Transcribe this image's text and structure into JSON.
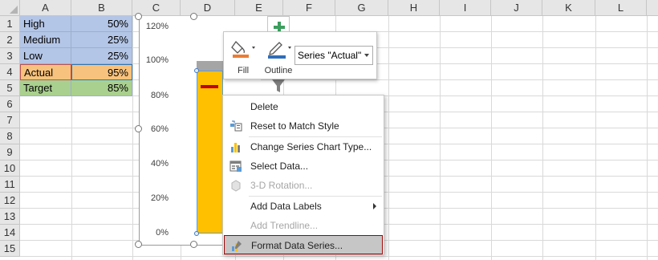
{
  "columns": [
    "A",
    "B",
    "C",
    "D",
    "E",
    "F",
    "G",
    "H",
    "I",
    "J",
    "K",
    "L"
  ],
  "rows": [
    "1",
    "2",
    "3",
    "4",
    "5",
    "6",
    "7",
    "8",
    "9",
    "10",
    "11",
    "12",
    "13",
    "14",
    "15"
  ],
  "cells": [
    {
      "label": "High",
      "value": "50%"
    },
    {
      "label": "Medium",
      "value": "25%"
    },
    {
      "label": "Low",
      "value": "25%"
    },
    {
      "label": "Actual",
      "value": "95%"
    },
    {
      "label": "Target",
      "value": "85%"
    }
  ],
  "chart": {
    "yticks": [
      "120%",
      "100%",
      "80%",
      "60%",
      "40%",
      "20%",
      "0%"
    ]
  },
  "chart_data": {
    "type": "bar",
    "categories": [
      ""
    ],
    "series": [
      {
        "values": [
          100
        ],
        "color": "#a5a5a5"
      },
      {
        "name": "Actual",
        "values": [
          95
        ],
        "color": "#ffc000"
      },
      {
        "values": [
          85
        ],
        "color": "#c00000"
      }
    ],
    "ylim": [
      0,
      120
    ],
    "yticks": [
      "120%",
      "100%",
      "80%",
      "60%",
      "40%",
      "20%",
      "0%"
    ]
  },
  "mini_toolbar": {
    "fill_label": "Fill",
    "outline_label": "Outline",
    "series_selector": "Series \"Actual\""
  },
  "context_menu": {
    "items": [
      {
        "label": "Delete",
        "icon": "none",
        "enabled": true
      },
      {
        "label": "Reset to Match Style",
        "icon": "reset-style-icon",
        "enabled": true
      },
      {
        "label": "Change Series Chart Type...",
        "icon": "bar-chart-icon",
        "enabled": true
      },
      {
        "label": "Select Data...",
        "icon": "select-data-icon",
        "enabled": true
      },
      {
        "label": "3-D Rotation...",
        "icon": "cube-icon",
        "enabled": false
      },
      {
        "label": "Add Data Labels",
        "icon": "none",
        "enabled": true,
        "submenu": true
      },
      {
        "label": "Add Trendline...",
        "icon": "none",
        "enabled": false
      },
      {
        "label": "Format Data Series...",
        "icon": "format-series-icon",
        "enabled": true,
        "highlighted": true
      }
    ]
  },
  "colors": {
    "blue_fill": "#b4c6e7",
    "orange_fill": "#f7c27d",
    "green_fill": "#a9d08e",
    "bar_actual": "#ffc000",
    "bar_top": "#a5a5a5",
    "target_marker": "#c00000",
    "menu_highlight_border": "#a00000"
  }
}
